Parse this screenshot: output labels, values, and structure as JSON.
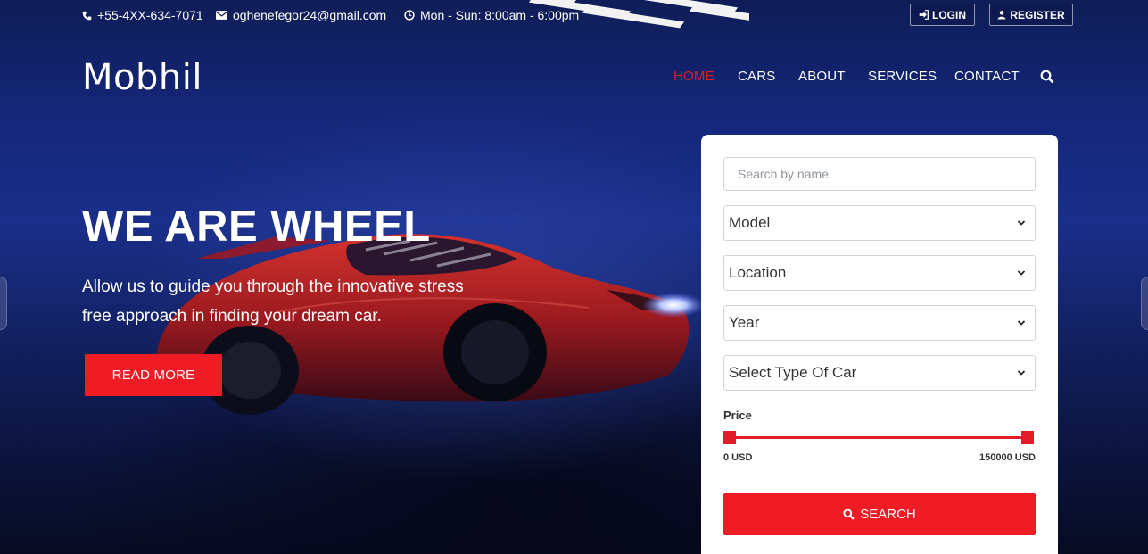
{
  "topbar": {
    "phone": "+55-4XX-634-7071",
    "email": "oghenefegor24@gmail.com",
    "hours": "Mon - Sun: 8:00am - 6:00pm",
    "login_label": "LOGIN",
    "register_label": "REGISTER",
    "icons": [
      "phone-icon",
      "envelope-icon",
      "clock-icon",
      "sign-in-icon",
      "user-icon"
    ]
  },
  "brand": {
    "logo": "Mobhil"
  },
  "nav": {
    "items": [
      {
        "label": "HOME",
        "active": true
      },
      {
        "label": "CARS",
        "active": false
      },
      {
        "label": "ABOUT",
        "active": false
      },
      {
        "label": "SERVICES",
        "active": false
      },
      {
        "label": "CONTACT",
        "active": false
      }
    ],
    "search_icon": "search-icon"
  },
  "hero": {
    "headline": "WE ARE WHEEL",
    "subcopy_line1": "Allow us to guide you through the innovative stress",
    "subcopy_line2": "free approach in finding your dream car.",
    "cta_label": "READ MORE"
  },
  "search_form": {
    "name_placeholder": "Search by name",
    "model_selected": "Model",
    "location_selected": "Location",
    "year_selected": "Year",
    "type_selected": "Select Type Of Car",
    "price_label": "Price",
    "price_min": "0 USD",
    "price_max": "150000 USD",
    "price_range_fraction": [
      0,
      1
    ],
    "submit_label": "SEARCH"
  },
  "colors": {
    "accent": "#ef1b25",
    "nav_active": "#e11d2a",
    "hero_bg": "#14277a",
    "card_bg": "#ffffff"
  }
}
